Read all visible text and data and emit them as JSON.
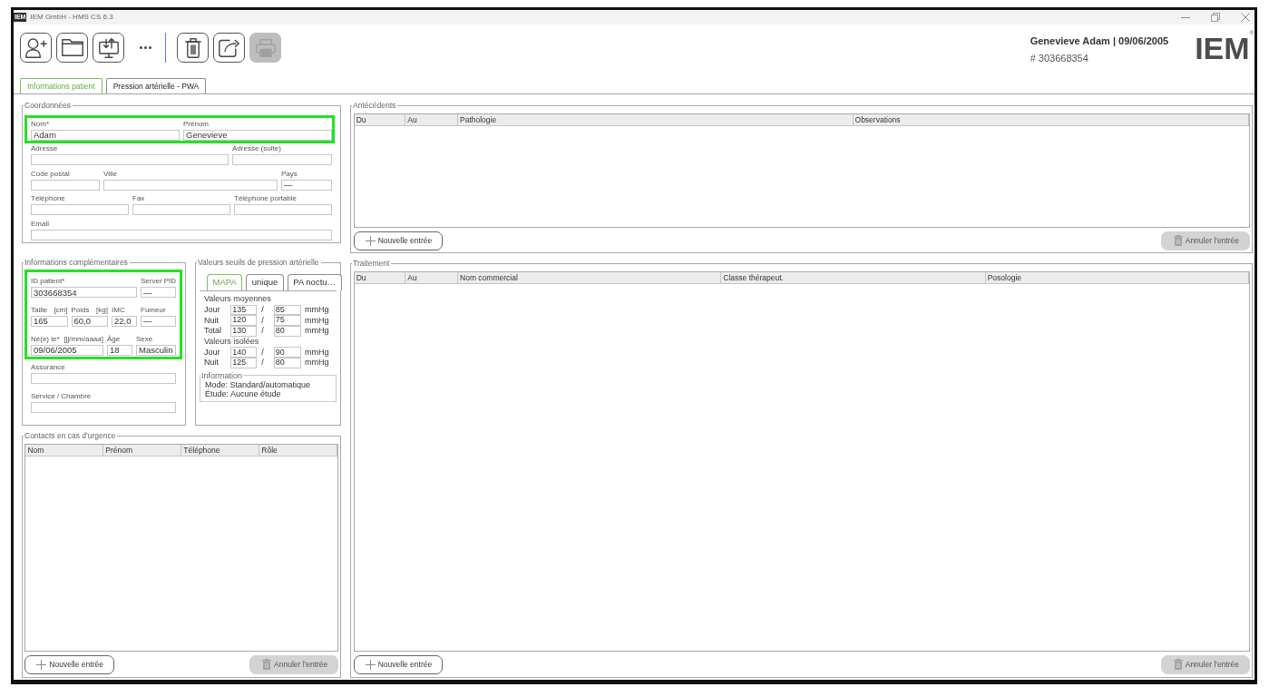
{
  "window": {
    "app_icon": "IEM",
    "title": "IEM GmbH - HMS CS 6.3"
  },
  "toolbar": [
    {
      "kind": "button",
      "disabled": false
    },
    {
      "kind": "button",
      "disabled": false
    },
    {
      "kind": "button",
      "disabled": false
    },
    {
      "kind": "more"
    },
    {
      "kind": "separator"
    },
    {
      "kind": "button",
      "disabled": false
    },
    {
      "kind": "button",
      "disabled": false
    },
    {
      "kind": "button",
      "disabled": true
    }
  ],
  "patient_header": {
    "name_line": "Genevieve Adam | 09/06/2005",
    "id_line": "# 303668354"
  },
  "logo": "IEM$^{®}$",
  "tabs": [
    {
      "label": "Informations patient",
      "selected": true
    },
    {
      "label": "Pression artérielle - PWA",
      "selected": false
    }
  ],
  "coordonnees": {
    "title": "Coordonnées",
    "groups": [
      {
        "highlighted": true,
        "fields": [
          {
            "label": "Nom*",
            "value": "Adam"
          },
          {
            "label": "Prénom",
            "value": "Genevieve"
          }
        ]
      },
      {
        "highlighted": false,
        "fields": [
          {
            "label": "Adresse"
          },
          {
            "label": "Adresse (suite)"
          },
          {
            "label": "Code postal"
          },
          {
            "label": "Ville"
          },
          {
            "label": "Pays",
            "value": "—"
          },
          {
            "label": "Téléphone"
          },
          {
            "label": "Fax"
          },
          {
            "label": "Téléphone portable"
          },
          {
            "label": "Email"
          }
        ]
      }
    ]
  },
  "informations_complementaires": {
    "title": "Informations complémentaires",
    "groups": [
      {
        "highlighted": true,
        "fields": [
          {
            "label": "ID patient*",
            "value": "303668354"
          },
          {
            "label": "Server PID",
            "value": "—"
          },
          {
            "label": "Taille",
            "unit": "[cm]",
            "value": "165"
          },
          {
            "label": "Poids",
            "unit": "[kg]",
            "value": "60,0"
          },
          {
            "label": "IMC",
            "value": "22,0"
          },
          {
            "label": "Fumeur",
            "value": "—"
          },
          {
            "label": "Né(e) le*",
            "unit": "[jj/mm/aaaa]",
            "value": "09/06/2005"
          },
          {
            "label": "Âge",
            "value": "18"
          },
          {
            "label": "Sexe",
            "value": "Masculin"
          }
        ]
      },
      {
        "highlighted": false,
        "fields": [
          {
            "label": "Assurance"
          },
          {
            "label": "Service / Chambre"
          }
        ]
      }
    ]
  },
  "valeurs_seuils": {
    "title": "Valeurs seuils de pression artérielle",
    "tabs": [
      {
        "label": "MAPA",
        "selected": true
      },
      {
        "label": "unique",
        "selected": false
      },
      {
        "label": "PA noctu…",
        "selected": false
      }
    ],
    "sections": [
      {
        "title": "Valeurs moyennes",
        "rows": [
          {
            "label": "Jour",
            "values": [
              "135",
              "85"
            ],
            "separator": "/",
            "unit": "mmHg"
          },
          {
            "label": "Nuit",
            "values": [
              "120",
              "75"
            ],
            "separator": "/",
            "unit": "mmHg"
          },
          {
            "label": "Total",
            "values": [
              "130",
              "80"
            ],
            "separator": "/",
            "unit": "mmHg"
          }
        ]
      },
      {
        "title": "Valeurs isolées",
        "rows": [
          {
            "label": "Jour",
            "values": [
              "140",
              "90"
            ],
            "separator": "/",
            "unit": "mmHg"
          },
          {
            "label": "Nuit",
            "values": [
              "125",
              "80"
            ],
            "separator": "/",
            "unit": "mmHg"
          }
        ]
      }
    ],
    "information": {
      "title": "Information",
      "lines": [
        "Mode: Standard/automatique",
        "Étude: Aucune étude"
      ]
    }
  },
  "contacts": {
    "title": "Contacts en cas d'urgence",
    "columns": [
      "Nom",
      "Prénom",
      "Téléphone",
      "Rôle"
    ],
    "buttons": [
      {
        "kind": "add",
        "label": "Nouvelle entrée",
        "disabled": false
      },
      {
        "kind": "delete",
        "label": "Annuler l'entrée",
        "disabled": true
      }
    ]
  },
  "antecedents": {
    "title": "Antécédents",
    "columns": [
      "Du",
      "Au",
      "Pathologie",
      "Observations"
    ],
    "buttons": [
      {
        "kind": "add",
        "label": "Nouvelle entrée",
        "disabled": false
      },
      {
        "kind": "delete",
        "label": "Annuler l'entrée",
        "disabled": true
      }
    ]
  },
  "traitement": {
    "title": "Traitement",
    "columns": [
      "Du",
      "Au",
      "Nom commercial",
      "Classe thérapeut.",
      "Posologie"
    ],
    "buttons": [
      {
        "kind": "add",
        "label": "Nouvelle entrée",
        "disabled": false
      },
      {
        "kind": "delete",
        "label": "Annuler l'entrée",
        "disabled": true
      }
    ]
  }
}
